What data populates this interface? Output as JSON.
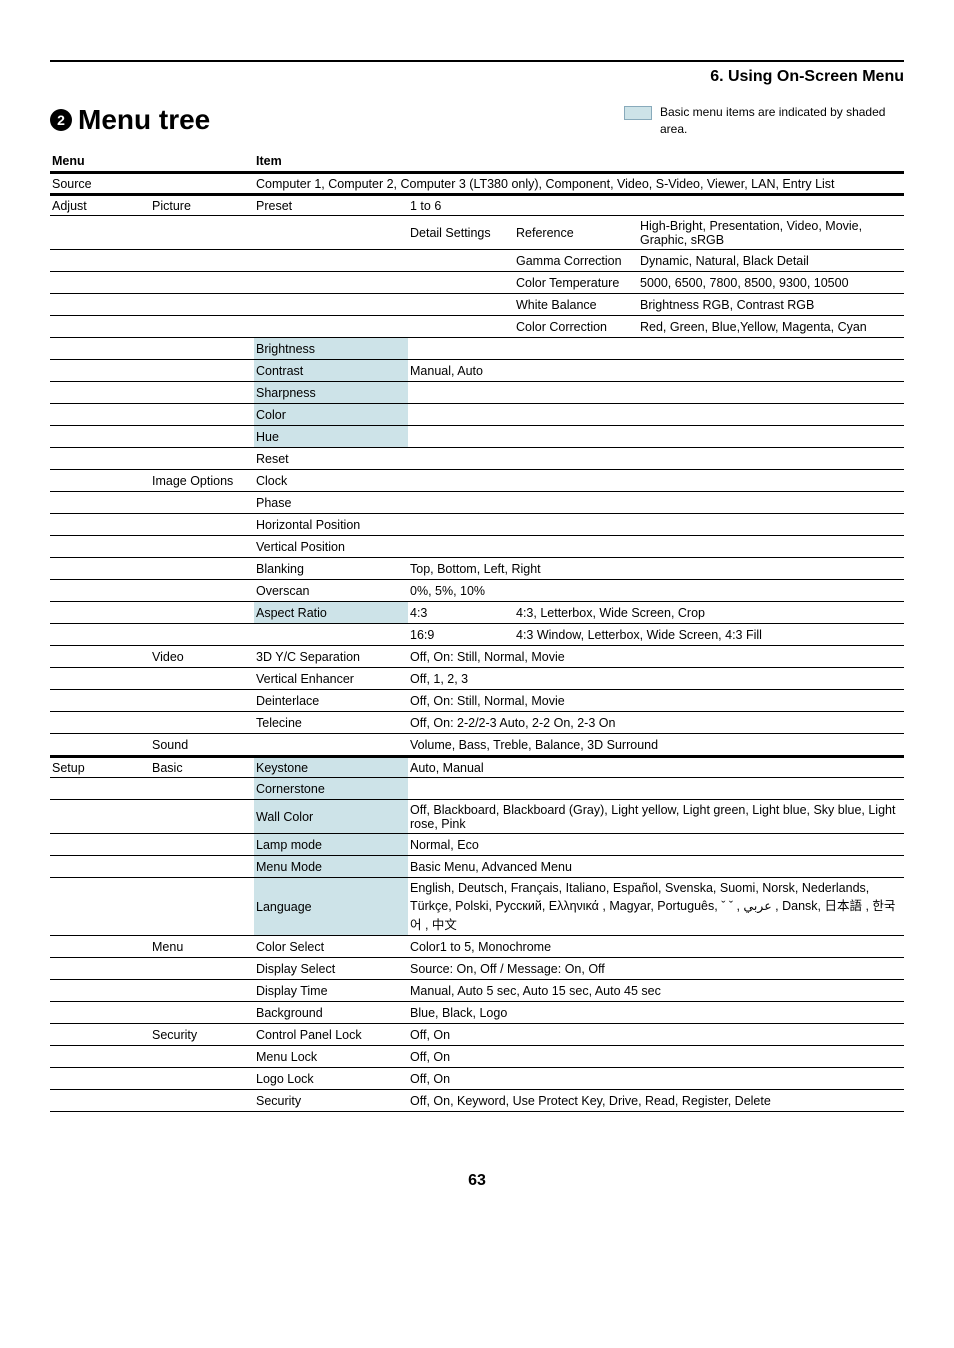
{
  "section_header": "6. Using On-Screen Menu",
  "bullet_num": "2",
  "page_title": "Menu tree",
  "legend_text": "Basic menu items are indicated by shaded area.",
  "headers": {
    "menu": "Menu",
    "item": "Item"
  },
  "page_number": "63",
  "rows": [
    {
      "c1": "Source",
      "c3_span": "Computer 1, Computer 2, Computer 3 (LT380 only), Component, Video, S-Video, Viewer, LAN, Entry List"
    },
    {
      "c1": "Adjust",
      "c2": "Picture",
      "c3": "Preset",
      "c4": "1 to 6"
    },
    {
      "c4": "Detail Settings",
      "c5": "Reference",
      "c6": "High-Bright, Presentation, Video, Movie, Graphic, sRGB"
    },
    {
      "c5": "Gamma Correction",
      "c6": "Dynamic, Natural, Black Detail"
    },
    {
      "c5": "Color Temperature",
      "c6": "5000, 6500, 7800, 8500, 9300, 10500"
    },
    {
      "c5": "White Balance",
      "c6": "Brightness RGB, Contrast RGB"
    },
    {
      "c5": "Color Correction",
      "c6": "Red, Green, Blue,Yellow, Magenta, Cyan"
    },
    {
      "c3": "Brightness",
      "shaded": true
    },
    {
      "c3": "Contrast",
      "c4": "Manual, Auto",
      "shaded": true
    },
    {
      "c3": "Sharpness",
      "shaded": true
    },
    {
      "c3": "Color",
      "shaded": true
    },
    {
      "c3": "Hue",
      "shaded": true
    },
    {
      "c3": "Reset"
    },
    {
      "c2": "Image Options",
      "c3": "Clock"
    },
    {
      "c3": "Phase"
    },
    {
      "c3": "Horizontal Position"
    },
    {
      "c3": "Vertical Position"
    },
    {
      "c3": "Blanking",
      "c4_span": "Top, Bottom, Left, Right"
    },
    {
      "c3": "Overscan",
      "c4_span": "0%, 5%, 10%"
    },
    {
      "c3": "Aspect Ratio",
      "c4": "4:3",
      "c5_span": "4:3, Letterbox, Wide Screen, Crop",
      "shaded": true
    },
    {
      "c4": "16:9",
      "c5_span": "4:3 Window, Letterbox, Wide Screen, 4:3 Fill"
    },
    {
      "c2": "Video",
      "c3": "3D Y/C Separation",
      "c4_span": "Off, On: Still, Normal, Movie"
    },
    {
      "c3": "Vertical Enhancer",
      "c4_span": "Off, 1, 2, 3"
    },
    {
      "c3": "Deinterlace",
      "c4_span": "Off, On: Still, Normal, Movie"
    },
    {
      "c3": "Telecine",
      "c4_span": "Off, On: 2-2/2-3 Auto, 2-2 On, 2-3 On"
    },
    {
      "c2": "Sound",
      "c4_span": "Volume, Bass, Treble, Balance, 3D Surround"
    },
    {
      "c1": "Setup",
      "c2": "Basic",
      "c3": "Keystone",
      "c4_span": "Auto, Manual",
      "shaded": true
    },
    {
      "c3": "Cornerstone",
      "shaded": true
    },
    {
      "c3": "Wall Color",
      "c4_span": "Off, Blackboard, Blackboard (Gray), Light yellow, Light green, Light blue, Sky blue, Light rose, Pink",
      "shaded": true
    },
    {
      "c3": "Lamp mode",
      "c4_span": "Normal, Eco",
      "shaded": true
    },
    {
      "c3": "Menu Mode",
      "c4_span": "Basic Menu, Advanced Menu",
      "shaded": true
    },
    {
      "c3": "Language",
      "c4_span": "English, Deutsch, Français, Italiano, Español, Svenska, Suomi, Norsk, Nederlands, Türkçe, Polski, Русский, Ελληνικά , Magyar, Português,     ˇ    ˇ  , عربي , Dansk, 日本語 , 한국어 , 中文",
      "shaded": true
    },
    {
      "c2": "Menu",
      "c3": "Color Select",
      "c4_span": "Color1 to 5, Monochrome"
    },
    {
      "c3": "Display Select",
      "c4_span": "Source: On, Off / Message: On, Off"
    },
    {
      "c3": "Display Time",
      "c4_span": "Manual, Auto 5 sec, Auto 15 sec, Auto 45 sec"
    },
    {
      "c3": "Background",
      "c4_span": "Blue, Black, Logo"
    },
    {
      "c2": "Security",
      "c3": "Control Panel Lock",
      "c4_span": "Off, On"
    },
    {
      "c3": "Menu Lock",
      "c4_span": "Off, On"
    },
    {
      "c3": "Logo Lock",
      "c4_span": "Off, On"
    },
    {
      "c3": "Security",
      "c4_span": "Off, On, Keyword, Use Protect Key, Drive, Read, Register, Delete"
    }
  ]
}
